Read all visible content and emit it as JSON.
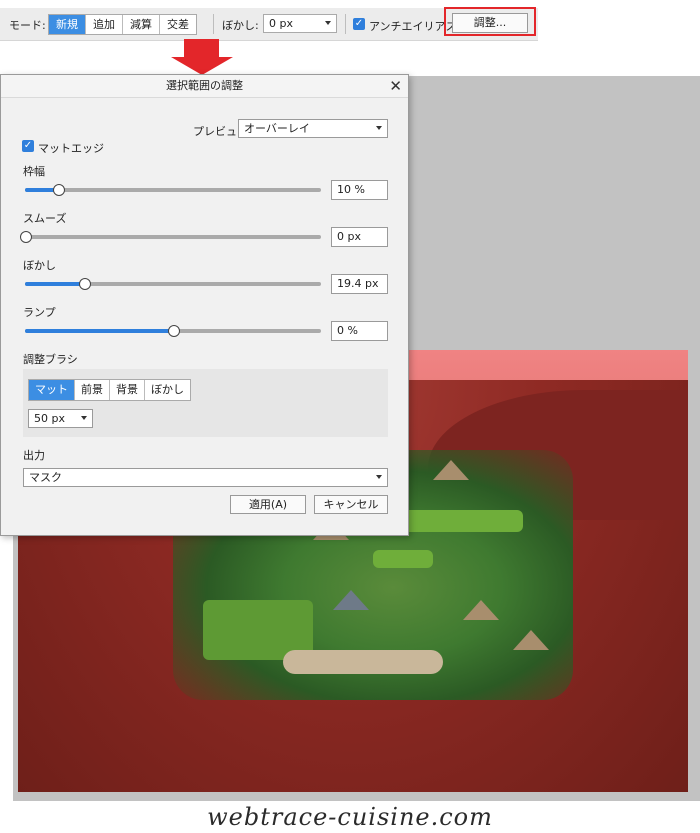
{
  "toolbar": {
    "mode_label": "モード:",
    "modes": [
      "新規",
      "追加",
      "減算",
      "交差"
    ],
    "active_mode": "新規",
    "blur_label": "ぼかし:",
    "blur_value": "0 px",
    "antialias_checked": true,
    "antialias_label": "アンチエイリアス",
    "adjust_button": "調整..."
  },
  "dialog": {
    "title": "選択範囲の調整",
    "close": "✕",
    "preview_label": "プレビュー",
    "preview_value": "オーバーレイ",
    "matte_edge_checked": true,
    "matte_edge_label": "マットエッジ",
    "sliders": [
      {
        "label": "枠幅",
        "value_text": "10 %",
        "fraction": 0.11
      },
      {
        "label": "スムーズ",
        "value_text": "0 px",
        "fraction": 0.0
      },
      {
        "label": "ぼかし",
        "value_text": "19.4 px",
        "fraction": 0.2
      },
      {
        "label": "ランプ",
        "value_text": "0 %",
        "fraction": 0.5
      }
    ],
    "brush_label": "調整ブラシ",
    "brush_modes": [
      "マット",
      "前景",
      "背景",
      "ぼかし"
    ],
    "active_brush_mode": "マット",
    "brush_size": "50 px",
    "output_label": "出力",
    "output_value": "マスク",
    "apply_button": "適用(A)",
    "cancel_button": "キャンセル"
  },
  "watermark": "webtrace-cuisine.com",
  "colors": {
    "accent": "#2f7fdc",
    "highlight": "#e3262a",
    "overlay": "#c0392b"
  }
}
